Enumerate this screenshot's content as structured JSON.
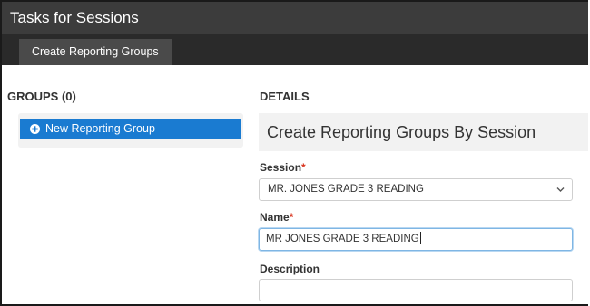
{
  "window": {
    "title": "Tasks for Sessions"
  },
  "tabs": [
    {
      "label": "Create Reporting Groups",
      "active": true
    }
  ],
  "groups": {
    "heading": "GROUPS (0)",
    "new_button_label": "New Reporting Group",
    "new_button_icon": "plus-circle-icon"
  },
  "details": {
    "heading": "DETAILS",
    "title": "Create Reporting Groups By Session",
    "session": {
      "label": "Session",
      "required_marker": "*",
      "selected_value": "MR. JONES GRADE 3 READING"
    },
    "name": {
      "label": "Name",
      "required_marker": "*",
      "value": "MR JONES GRADE 3 READING"
    },
    "description": {
      "label": "Description",
      "value": ""
    }
  },
  "colors": {
    "titlebar_bg": "#3c3c3c",
    "tabbar_bg": "#2a2a2a",
    "active_tab_bg": "#4a4a4a",
    "primary_button": "#1a7bd1",
    "required_asterisk": "#d9341e",
    "focused_input_border": "#7fb6e4"
  }
}
